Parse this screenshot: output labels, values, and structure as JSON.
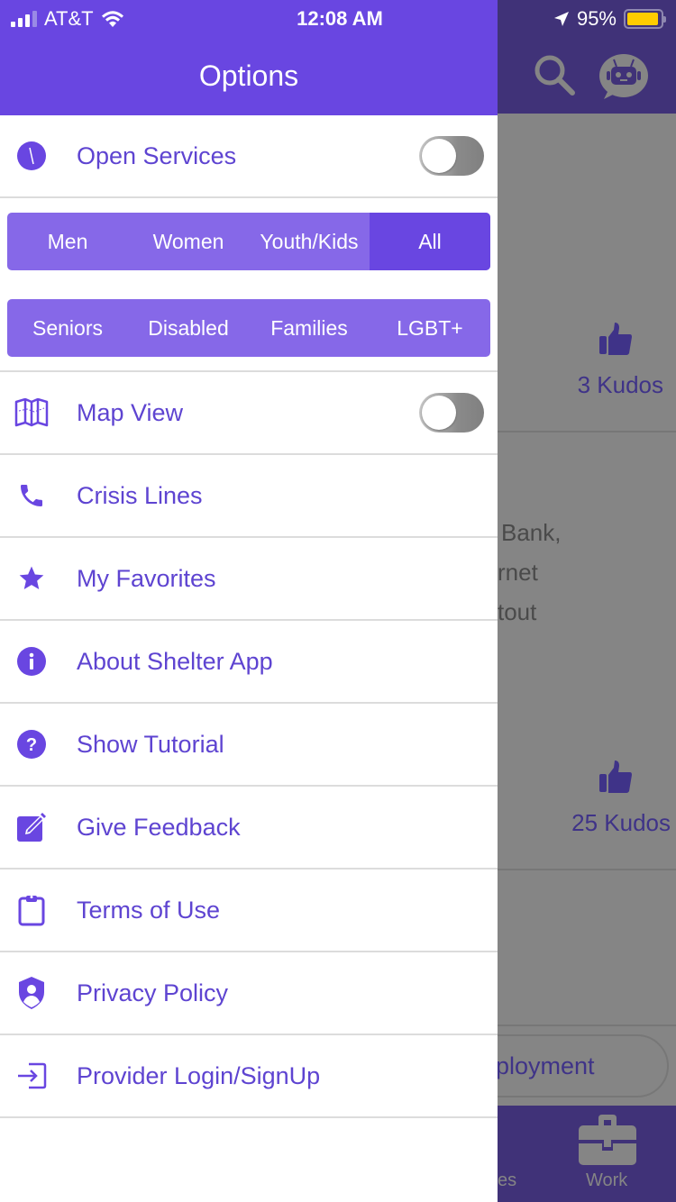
{
  "status_bar": {
    "carrier": "AT&T",
    "time": "12:08 AM",
    "battery_percent": "95%",
    "battery_level": 0.95
  },
  "drawer": {
    "title": "Options",
    "open_services": {
      "label": "Open Services",
      "toggle_on": false
    },
    "audience_filter": {
      "options": [
        "Men",
        "Women",
        "Youth/Kids",
        "All"
      ],
      "selected": "All"
    },
    "group_filter": {
      "options": [
        "Seniors",
        "Disabled",
        "Families",
        "LGBT+"
      ],
      "selected": null
    },
    "map_view": {
      "label": "Map View",
      "toggle_on": false
    },
    "menu_items": [
      {
        "label": "Crisis Lines",
        "icon": "phone-icon"
      },
      {
        "label": "My Favorites",
        "icon": "star-icon"
      },
      {
        "label": "About Shelter App",
        "icon": "info-icon"
      },
      {
        "label": "Show Tutorial",
        "icon": "help-icon"
      },
      {
        "label": "Give Feedback",
        "icon": "edit-icon"
      },
      {
        "label": "Terms of Use",
        "icon": "clipboard-icon"
      },
      {
        "label": "Privacy Policy",
        "icon": "shield-user-icon"
      },
      {
        "label": "Provider Login/SignUp",
        "icon": "login-icon"
      }
    ]
  },
  "background": {
    "kudos": [
      "3 Kudos",
      "25 Kudos"
    ],
    "text_fragments": [
      "Bank,",
      "rnet",
      "tout"
    ],
    "category_pill": "ployment",
    "tabs": [
      {
        "label": "es"
      },
      {
        "label": "Work",
        "icon": "briefcase-icon"
      }
    ]
  },
  "colors": {
    "primary": "#6946e1",
    "segment_bg": "#8668e8",
    "label_text": "#5e44d1",
    "battery": "#ffcc00"
  }
}
